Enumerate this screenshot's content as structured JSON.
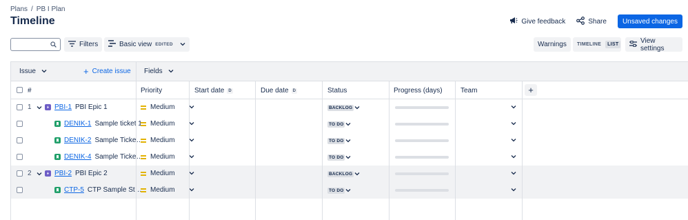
{
  "breadcrumb": {
    "root": "Plans",
    "sep": "/",
    "plan": "PB I Plan"
  },
  "page_title": "Timeline",
  "actions": {
    "feedback": "Give feedback",
    "share": "Share",
    "unsaved": "Unsaved changes"
  },
  "toolbar": {
    "filters": "Filters",
    "view": "Basic view",
    "edited": "EDITED",
    "warnings": "Warnings",
    "seg_timeline": "TIMELINE",
    "seg_list": "LIST",
    "view_settings": "View settings"
  },
  "grid": {
    "issue_menu": "Issue",
    "create_issue": "Create issue",
    "fields_menu": "Fields",
    "columns": {
      "hash": "#",
      "priority": "Priority",
      "start_date": "Start date",
      "due_date": "Due date",
      "date_badge": "D",
      "status": "Status",
      "progress": "Progress (days)",
      "team": "Team"
    },
    "add_column": "+"
  },
  "rows": [
    {
      "num": "1",
      "type": "epic",
      "key": "PBI-1",
      "summary": "PBI Epic 1",
      "priority": "Medium",
      "status": "BACKLOG",
      "progress": 0,
      "shaded": false
    },
    {
      "num": "",
      "type": "story",
      "key": "DENIK-1",
      "summary": "Sample ticket 1",
      "priority": "Medium",
      "status": "TO DO",
      "progress": 0,
      "shaded": false
    },
    {
      "num": "",
      "type": "story",
      "key": "DENIK-2",
      "summary": "Sample Ticke…",
      "priority": "Medium",
      "status": "TO DO",
      "progress": 0,
      "shaded": false
    },
    {
      "num": "",
      "type": "story",
      "key": "DENIK-4",
      "summary": "Sample Ticke…",
      "priority": "Medium",
      "status": "TO DO",
      "progress": 0,
      "shaded": false
    },
    {
      "num": "2",
      "type": "epic",
      "key": "PBI-2",
      "summary": "PBI Epic 2",
      "priority": "Medium",
      "status": "BACKLOG",
      "progress": 0,
      "shaded": true
    },
    {
      "num": "",
      "type": "story",
      "key": "CTP-5",
      "summary": "CTP Sample St…",
      "priority": "Medium",
      "status": "TO DO",
      "progress": 0,
      "shaded": true
    }
  ]
}
